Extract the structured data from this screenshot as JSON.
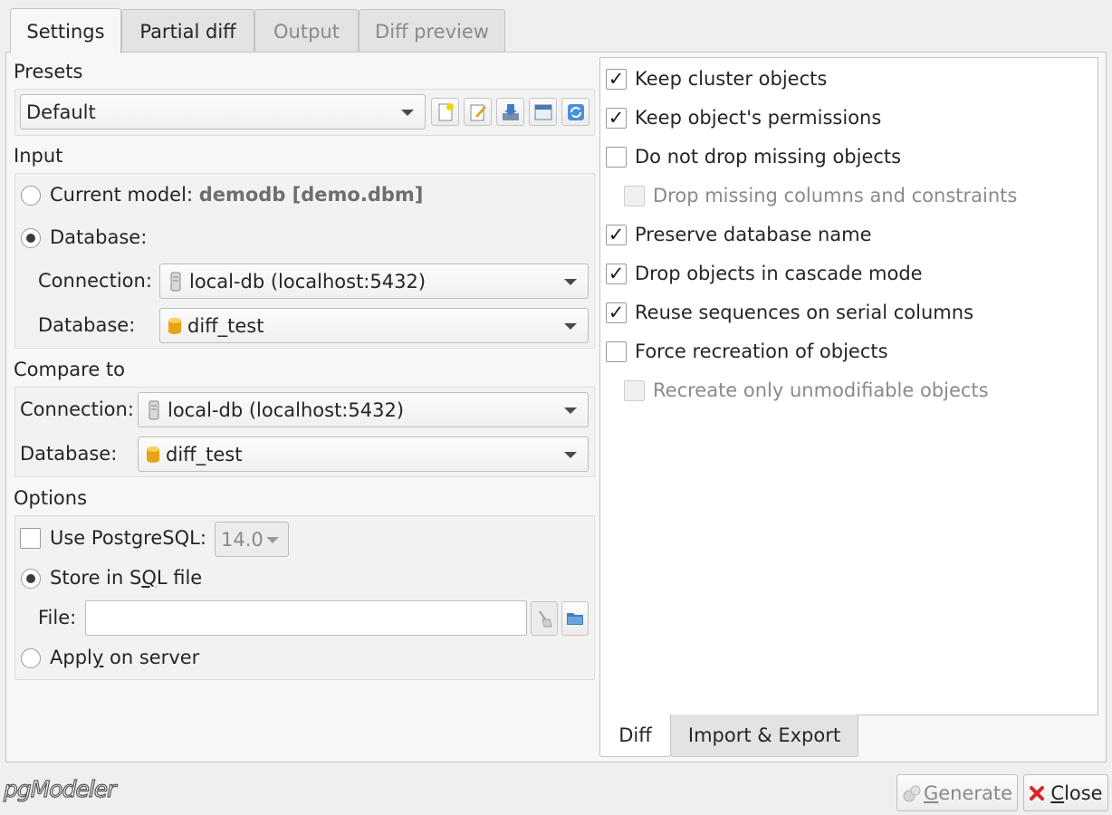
{
  "tabs": [
    {
      "label": "Settings",
      "state": "active"
    },
    {
      "label": "Partial diff",
      "state": "normal"
    },
    {
      "label": "Output",
      "state": "disabled"
    },
    {
      "label": "Diff preview",
      "state": "disabled"
    }
  ],
  "presets": {
    "section_label": "Presets",
    "selected": "Default",
    "tools": [
      "new-preset-icon",
      "edit-preset-icon",
      "save-preset-icon",
      "remove-preset-icon",
      "restore-defaults-icon"
    ]
  },
  "input": {
    "section_label": "Input",
    "current_model_label": "Current model:",
    "current_model_value": "demodb [demo.dbm]",
    "database_radio_label": "Database:",
    "connection_label": "Connection:",
    "connection_value": "local-db (localhost:5432)",
    "database_label": "Database:",
    "database_value": "diff_test"
  },
  "compare_to": {
    "section_label": "Compare to",
    "connection_label": "Connection:",
    "connection_value": "local-db (localhost:5432)",
    "database_label": "Database:",
    "database_value": "diff_test"
  },
  "options": {
    "section_label": "Options",
    "use_pgsql_label": "Use PostgreSQL:",
    "pgsql_version": "14.0",
    "store_sql_label_pre": "Store in S",
    "store_sql_label_u": "Q",
    "store_sql_label_post": "L file",
    "file_label": "File:",
    "file_value": "",
    "apply_label_pre": "Appl",
    "apply_label_u": "y",
    "apply_label_post": " on server"
  },
  "diff_options": [
    {
      "label": "Keep cluster objects",
      "checked": true,
      "disabled": false
    },
    {
      "label": "Keep object's permissions",
      "checked": true,
      "disabled": false
    },
    {
      "label": "Do not drop missing objects",
      "checked": false,
      "disabled": false
    },
    {
      "label": "Drop missing columns and constraints",
      "checked": false,
      "disabled": true
    },
    {
      "label": "Preserve database name",
      "checked": true,
      "disabled": false
    },
    {
      "label": "Drop objects in cascade mode",
      "checked": true,
      "disabled": false
    },
    {
      "label": "Reuse sequences on serial columns",
      "checked": true,
      "disabled": false
    },
    {
      "label": "Force recreation of objects",
      "checked": false,
      "disabled": false
    },
    {
      "label": "Recreate only unmodifiable objects",
      "checked": false,
      "disabled": true
    }
  ],
  "bottom_tabs": [
    {
      "label": "Diff",
      "active": true
    },
    {
      "label": "Import & Export",
      "active": false
    }
  ],
  "footer": {
    "logo_text": "pgModeler",
    "generate_pre": "",
    "generate_u": "G",
    "generate_post": "enerate",
    "close_pre": "",
    "close_u": "C",
    "close_post": "lose",
    "check_mark": "✓"
  },
  "colors": {
    "accent": "#3daee9",
    "close_icon": "#d62728",
    "db_icon": "#e8a317"
  }
}
